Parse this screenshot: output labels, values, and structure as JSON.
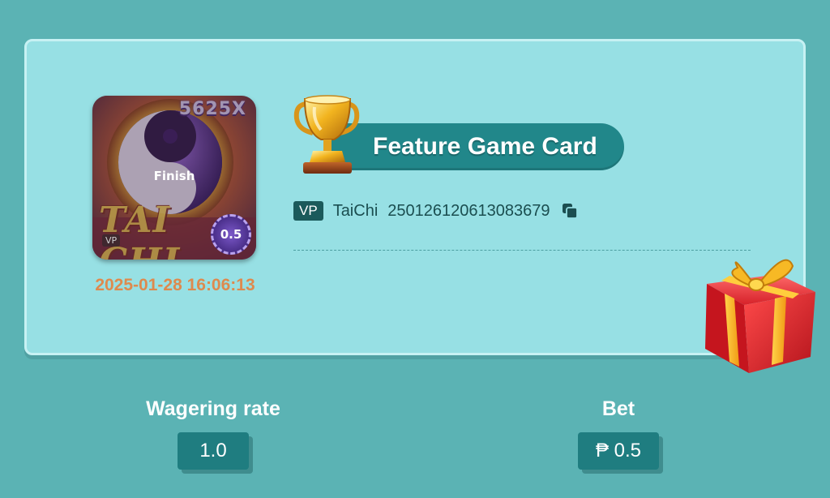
{
  "card": {
    "title": "Feature Game Card",
    "thumbnail": {
      "multiplier": "5625X",
      "title_art": "TAI CHI",
      "status": "Finish",
      "chip_value": "0.5",
      "provider": "VP"
    },
    "timestamp": "2025-01-28 16:06:13",
    "provider_badge": "VP",
    "game_name": "TaiChi",
    "round_id": "250126120613083679",
    "icons": {
      "trophy": "trophy-icon",
      "copy": "copy-icon",
      "gift": "gift-icon"
    }
  },
  "stats": {
    "wagering_rate": {
      "label": "Wagering rate",
      "value": "1.0"
    },
    "bet": {
      "label": "Bet",
      "value": "₱ 0.5"
    }
  },
  "colors": {
    "background": "#5bb3b4",
    "card": "#97e0e4",
    "accent": "#21878a",
    "timestamp": "#de8a4e"
  }
}
